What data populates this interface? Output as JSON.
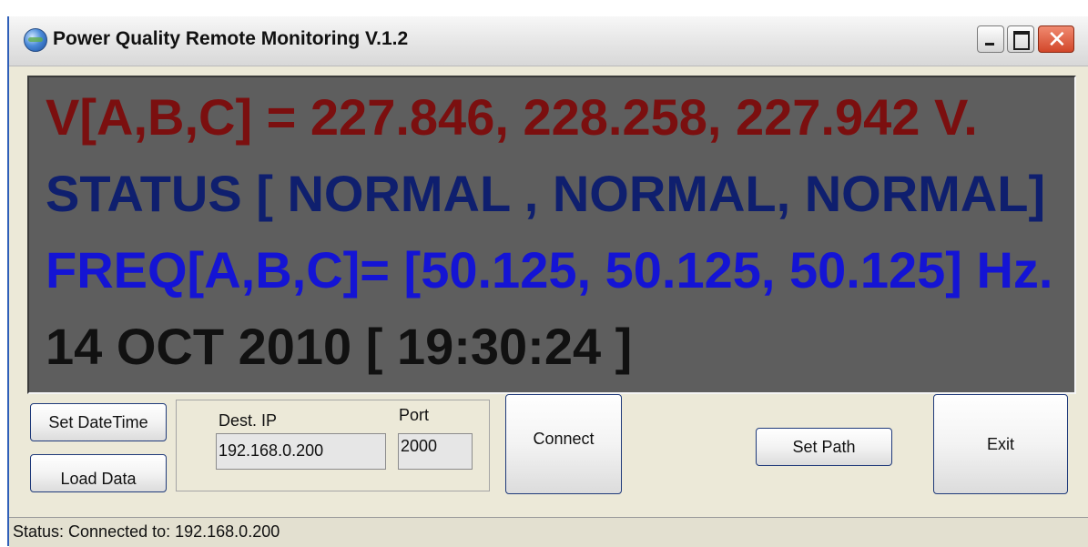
{
  "window": {
    "title": "Power Quality Remote Monitoring V.1.2",
    "icon": "globe-icon"
  },
  "display": {
    "voltage_line": "V[A,B,C] =  227.846, 228.258, 227.942 V.",
    "status_line": "STATUS [ NORMAL , NORMAL, NORMAL]",
    "frequency_line": "FREQ[A,B,C]= [50.125, 50.125, 50.125] Hz.",
    "datetime_line": "14 OCT 2010  [ 19:30:24 ]",
    "colors": {
      "background": "#5e5e5e",
      "voltage": "#7b0f0f",
      "status": "#0f1f6e",
      "frequency": "#1414d4",
      "datetime": "#111111"
    }
  },
  "controls": {
    "set_datetime_label": "Set DateTime",
    "load_data_label": "Load Data",
    "dest_ip_label": "Dest. IP",
    "dest_ip_value": "192.168.0.200",
    "port_label": "Port",
    "port_value": "2000",
    "connect_label": "Connect",
    "set_path_label": "Set Path",
    "exit_label": "Exit"
  },
  "statusbar": {
    "text": "Status: Connected to: 192.168.0.200"
  }
}
